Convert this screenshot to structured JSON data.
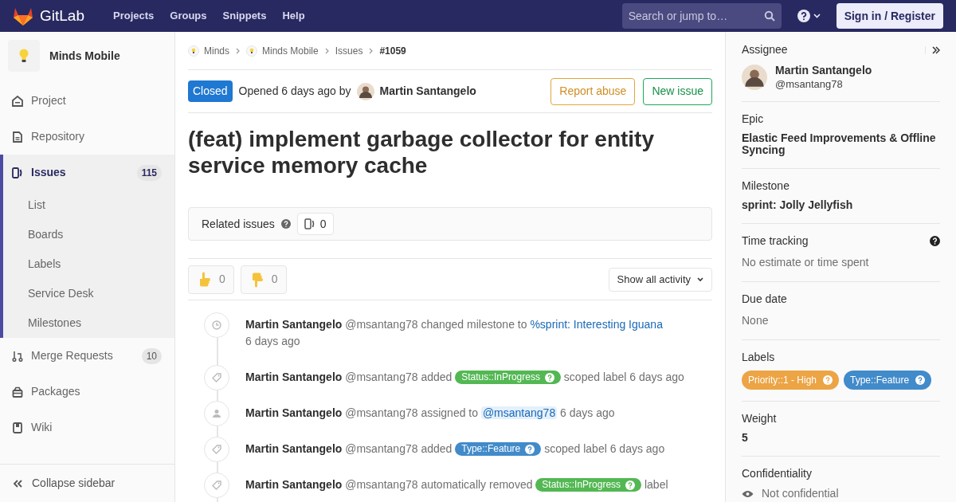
{
  "header": {
    "brand": "GitLab",
    "nav": [
      "Projects",
      "Groups",
      "Snippets",
      "Help"
    ],
    "search": {
      "placeholder": "Search or jump to…"
    },
    "sign_in": "Sign in / Register"
  },
  "project": {
    "name": "Minds Mobile"
  },
  "sidebar": {
    "items": [
      {
        "label": "Project",
        "kind": "home",
        "selected": false
      },
      {
        "label": "Repository",
        "kind": "doc",
        "selected": false
      },
      {
        "label": "Issues",
        "kind": "issues",
        "count": "115",
        "selected": true,
        "children": [
          {
            "label": "List"
          },
          {
            "label": "Boards"
          },
          {
            "label": "Labels"
          },
          {
            "label": "Service Desk"
          },
          {
            "label": "Milestones"
          }
        ]
      },
      {
        "label": "Merge Requests",
        "kind": "merge",
        "count": "10",
        "selected": false
      },
      {
        "label": "Packages",
        "kind": "package",
        "selected": false
      },
      {
        "label": "Wiki",
        "kind": "book",
        "selected": false
      }
    ],
    "collapse": "Collapse sidebar"
  },
  "breadcrumbs": [
    {
      "text": "Minds",
      "avatar": true
    },
    {
      "text": "Minds Mobile",
      "avatar": true
    },
    {
      "text": "Issues",
      "avatar": false
    },
    {
      "text": "#1059",
      "avatar": false
    }
  ],
  "issue": {
    "status": "Closed",
    "opened": "Opened 6 days ago by",
    "author": "Martin Santangelo",
    "report": "Report abuse",
    "new_issue": "New issue",
    "title": "(feat) implement garbage collector for entity service memory cache"
  },
  "related": {
    "label": "Related issues",
    "count": "0"
  },
  "awards": [
    {
      "kind": "up",
      "count": "0"
    },
    {
      "kind": "down",
      "count": "0"
    }
  ],
  "filter": "Show all activity",
  "events": [
    {
      "kind": "clock",
      "author": "Martin Santangelo",
      "username": "@msantang78",
      "parts": [
        {
          "kind": "text",
          "text": "changed milestone to"
        },
        {
          "kind": "link",
          "text": "%sprint: Interesting Iguana"
        },
        {
          "kind": "text",
          "text": "6 days ago"
        }
      ]
    },
    {
      "kind": "tag",
      "author": "Martin Santangelo",
      "username": "@msantang78",
      "parts": [
        {
          "kind": "text",
          "text": "added"
        },
        {
          "kind": "label",
          "text": "Status::InProgress",
          "color": "#53b853"
        },
        {
          "kind": "text",
          "text": "scoped label 6 days ago"
        }
      ]
    },
    {
      "kind": "person",
      "author": "Martin Santangelo",
      "username": "@msantang78",
      "parts": [
        {
          "kind": "text",
          "text": "assigned to"
        },
        {
          "kind": "mention",
          "text": "@msantang78"
        },
        {
          "kind": "text",
          "text": "6 days ago"
        }
      ]
    },
    {
      "kind": "tag",
      "author": "Martin Santangelo",
      "username": "@msantang78",
      "parts": [
        {
          "kind": "text",
          "text": "added"
        },
        {
          "kind": "label",
          "text": "Type::Feature",
          "color": "#428bca"
        },
        {
          "kind": "text",
          "text": "scoped label 6 days ago"
        }
      ]
    },
    {
      "kind": "tag",
      "author": "Martin Santangelo",
      "username": "@msantang78",
      "parts": [
        {
          "kind": "text",
          "text": "automatically removed"
        },
        {
          "kind": "label",
          "text": "Status::InProgress",
          "color": "#53b853"
        },
        {
          "kind": "text",
          "text": "label"
        }
      ]
    }
  ],
  "right": {
    "assignee": {
      "label": "Assignee",
      "name": "Martin Santangelo",
      "username": "@msantang78"
    },
    "sections": [
      {
        "kind": "bold",
        "label": "Epic",
        "value": "Elastic Feed Improvements & Offline Syncing",
        "help": false
      },
      {
        "kind": "bold",
        "label": "Milestone",
        "value": "sprint: Jolly Jellyfish",
        "help": false
      },
      {
        "kind": "muted",
        "label": "Time tracking",
        "value": "No estimate or time spent",
        "help": true
      },
      {
        "kind": "muted",
        "label": "Due date",
        "value": "None",
        "help": false
      },
      {
        "kind": "labels",
        "label": "Labels",
        "help": false,
        "labels": [
          {
            "text": "Priority::1 - High",
            "color": "#eca444"
          },
          {
            "text": "Type::Feature",
            "color": "#428bca"
          }
        ]
      },
      {
        "kind": "bold",
        "label": "Weight",
        "value": "5",
        "help": false
      },
      {
        "kind": "confidential",
        "label": "Confidentiality",
        "value": "Not confidential",
        "help": false
      }
    ]
  }
}
